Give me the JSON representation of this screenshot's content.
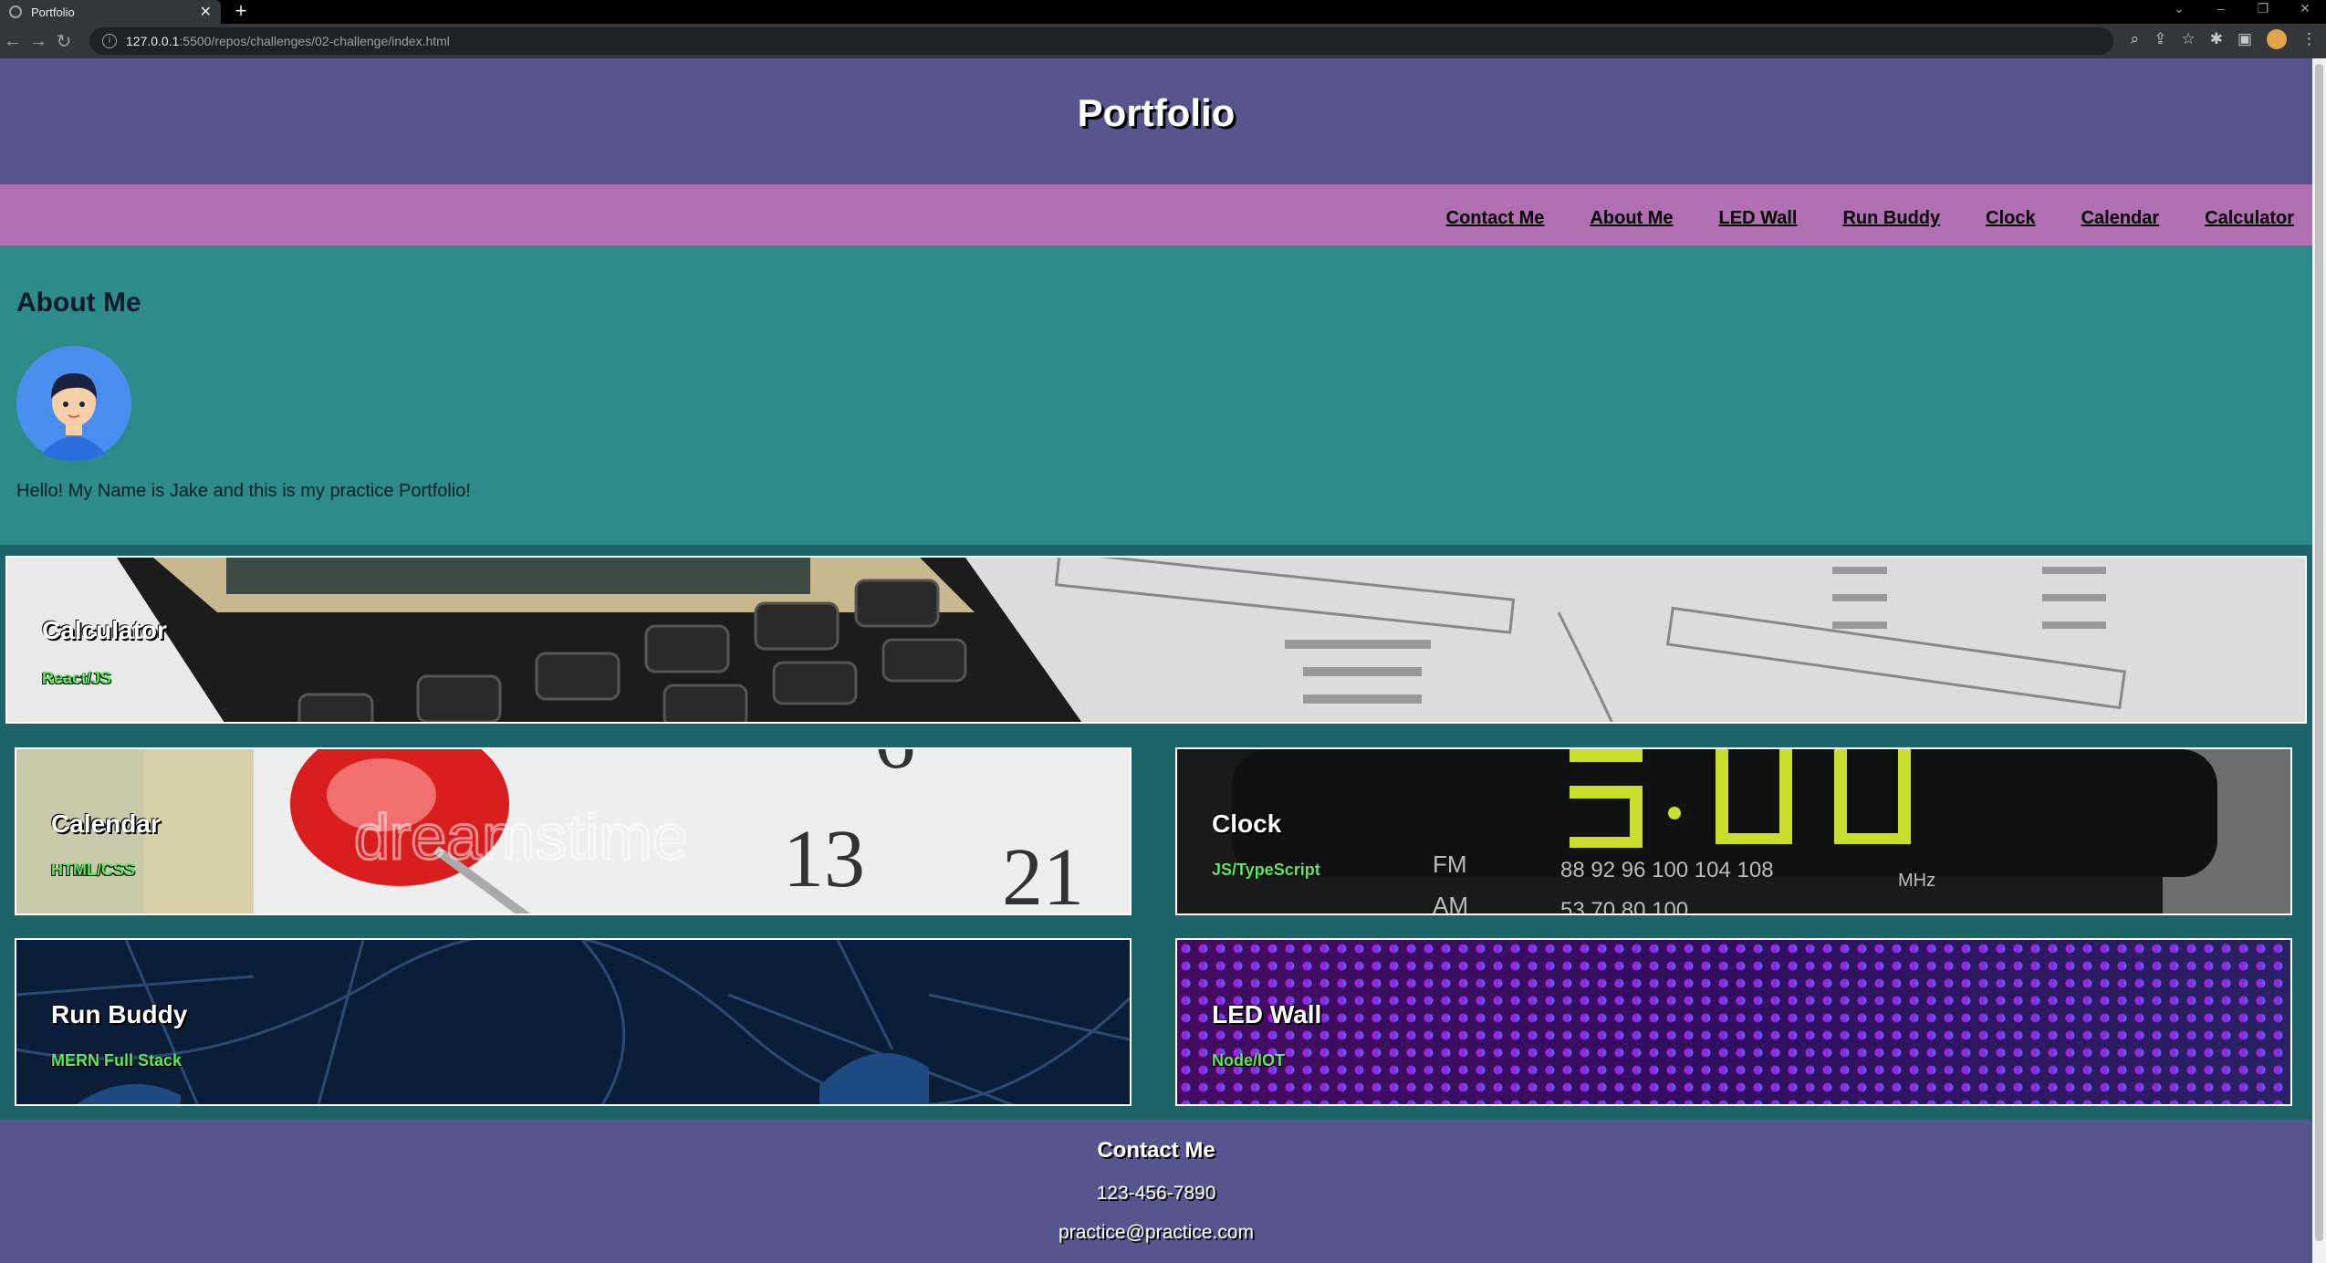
{
  "browser": {
    "tab_title": "Portfolio",
    "url_host": "127.0.0.1",
    "url_path": ":5500/repos/challenges/02-challenge/index.html"
  },
  "header": {
    "title": "Portfolio"
  },
  "nav": {
    "items": [
      {
        "label": "Contact Me"
      },
      {
        "label": "About Me"
      },
      {
        "label": "LED Wall"
      },
      {
        "label": "Run Buddy"
      },
      {
        "label": "Clock"
      },
      {
        "label": "Calendar"
      },
      {
        "label": "Calculator"
      }
    ]
  },
  "about": {
    "heading": "About Me",
    "text": "Hello! My Name is Jake and this is my practice Portfolio!"
  },
  "projects": {
    "calculator": {
      "title": "Calculator",
      "tech": "React/JS"
    },
    "calendar": {
      "title": "Calendar",
      "tech": "HTML/CSS"
    },
    "clock": {
      "title": "Clock",
      "tech": "JS/TypeScript"
    },
    "runbuddy": {
      "title": "Run Buddy",
      "tech": "MERN Full Stack"
    },
    "ledwall": {
      "title": "LED Wall",
      "tech": "Node/IOT"
    }
  },
  "footer": {
    "heading": "Contact Me",
    "phone": "123-456-7890",
    "email": "practice@practice.com"
  },
  "colors": {
    "header_bg": "#56558e",
    "nav_bg": "#b06fb1",
    "about_bg": "#2d8b8a",
    "projects_bg": "#1c6467",
    "subtitle_green": "#5ee860"
  }
}
